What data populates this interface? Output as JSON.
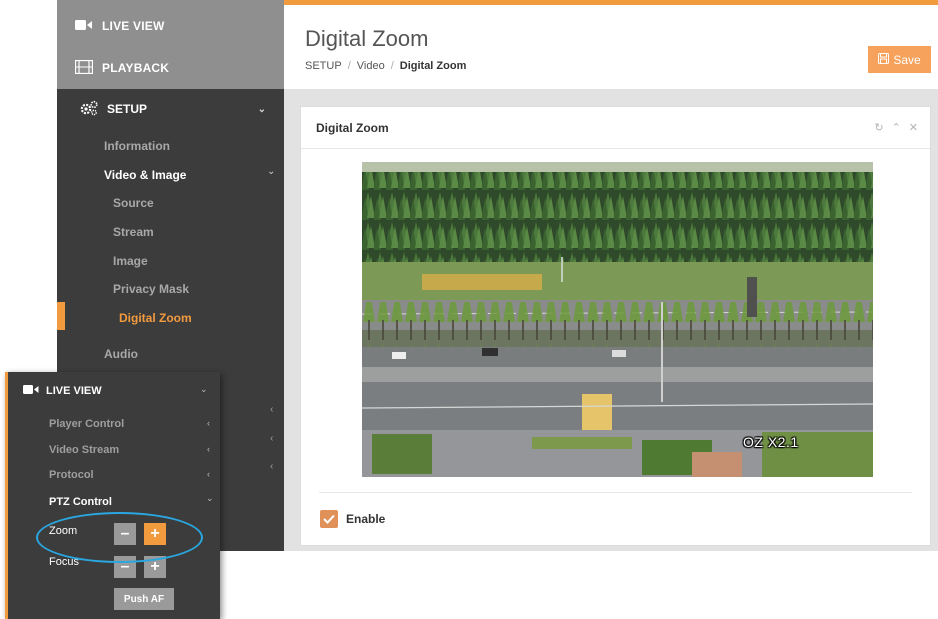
{
  "sidebar": {
    "live_view": "LIVE VIEW",
    "playback": "PLAYBACK",
    "setup": "SETUP",
    "items": {
      "information": "Information",
      "video_image": "Video & Image",
      "source": "Source",
      "stream": "Stream",
      "image": "Image",
      "privacy_mask": "Privacy Mask",
      "digital_zoom": "Digital Zoom",
      "audio": "Audio"
    }
  },
  "header": {
    "title": "Digital Zoom",
    "breadcrumb": [
      "SETUP",
      "Video",
      "Digital Zoom"
    ],
    "save_label": "Save"
  },
  "panel": {
    "title": "Digital Zoom",
    "video_overlay": "OZ X2.1",
    "enable_label": "Enable",
    "enable_checked": true
  },
  "inset": {
    "live_view": "LIVE VIEW",
    "player_control": "Player Control",
    "video_stream": "Video Stream",
    "protocol": "Protocol",
    "ptz_control": "PTZ Control",
    "zoom_label": "Zoom",
    "focus_label": "Focus",
    "push_af": "Push AF"
  },
  "colors": {
    "accent": "#f29a3e",
    "sidebar_dark": "#3c3c3c",
    "sidebar_top": "#8f8f8f",
    "highlight_ellipse": "#2aa7e0"
  }
}
